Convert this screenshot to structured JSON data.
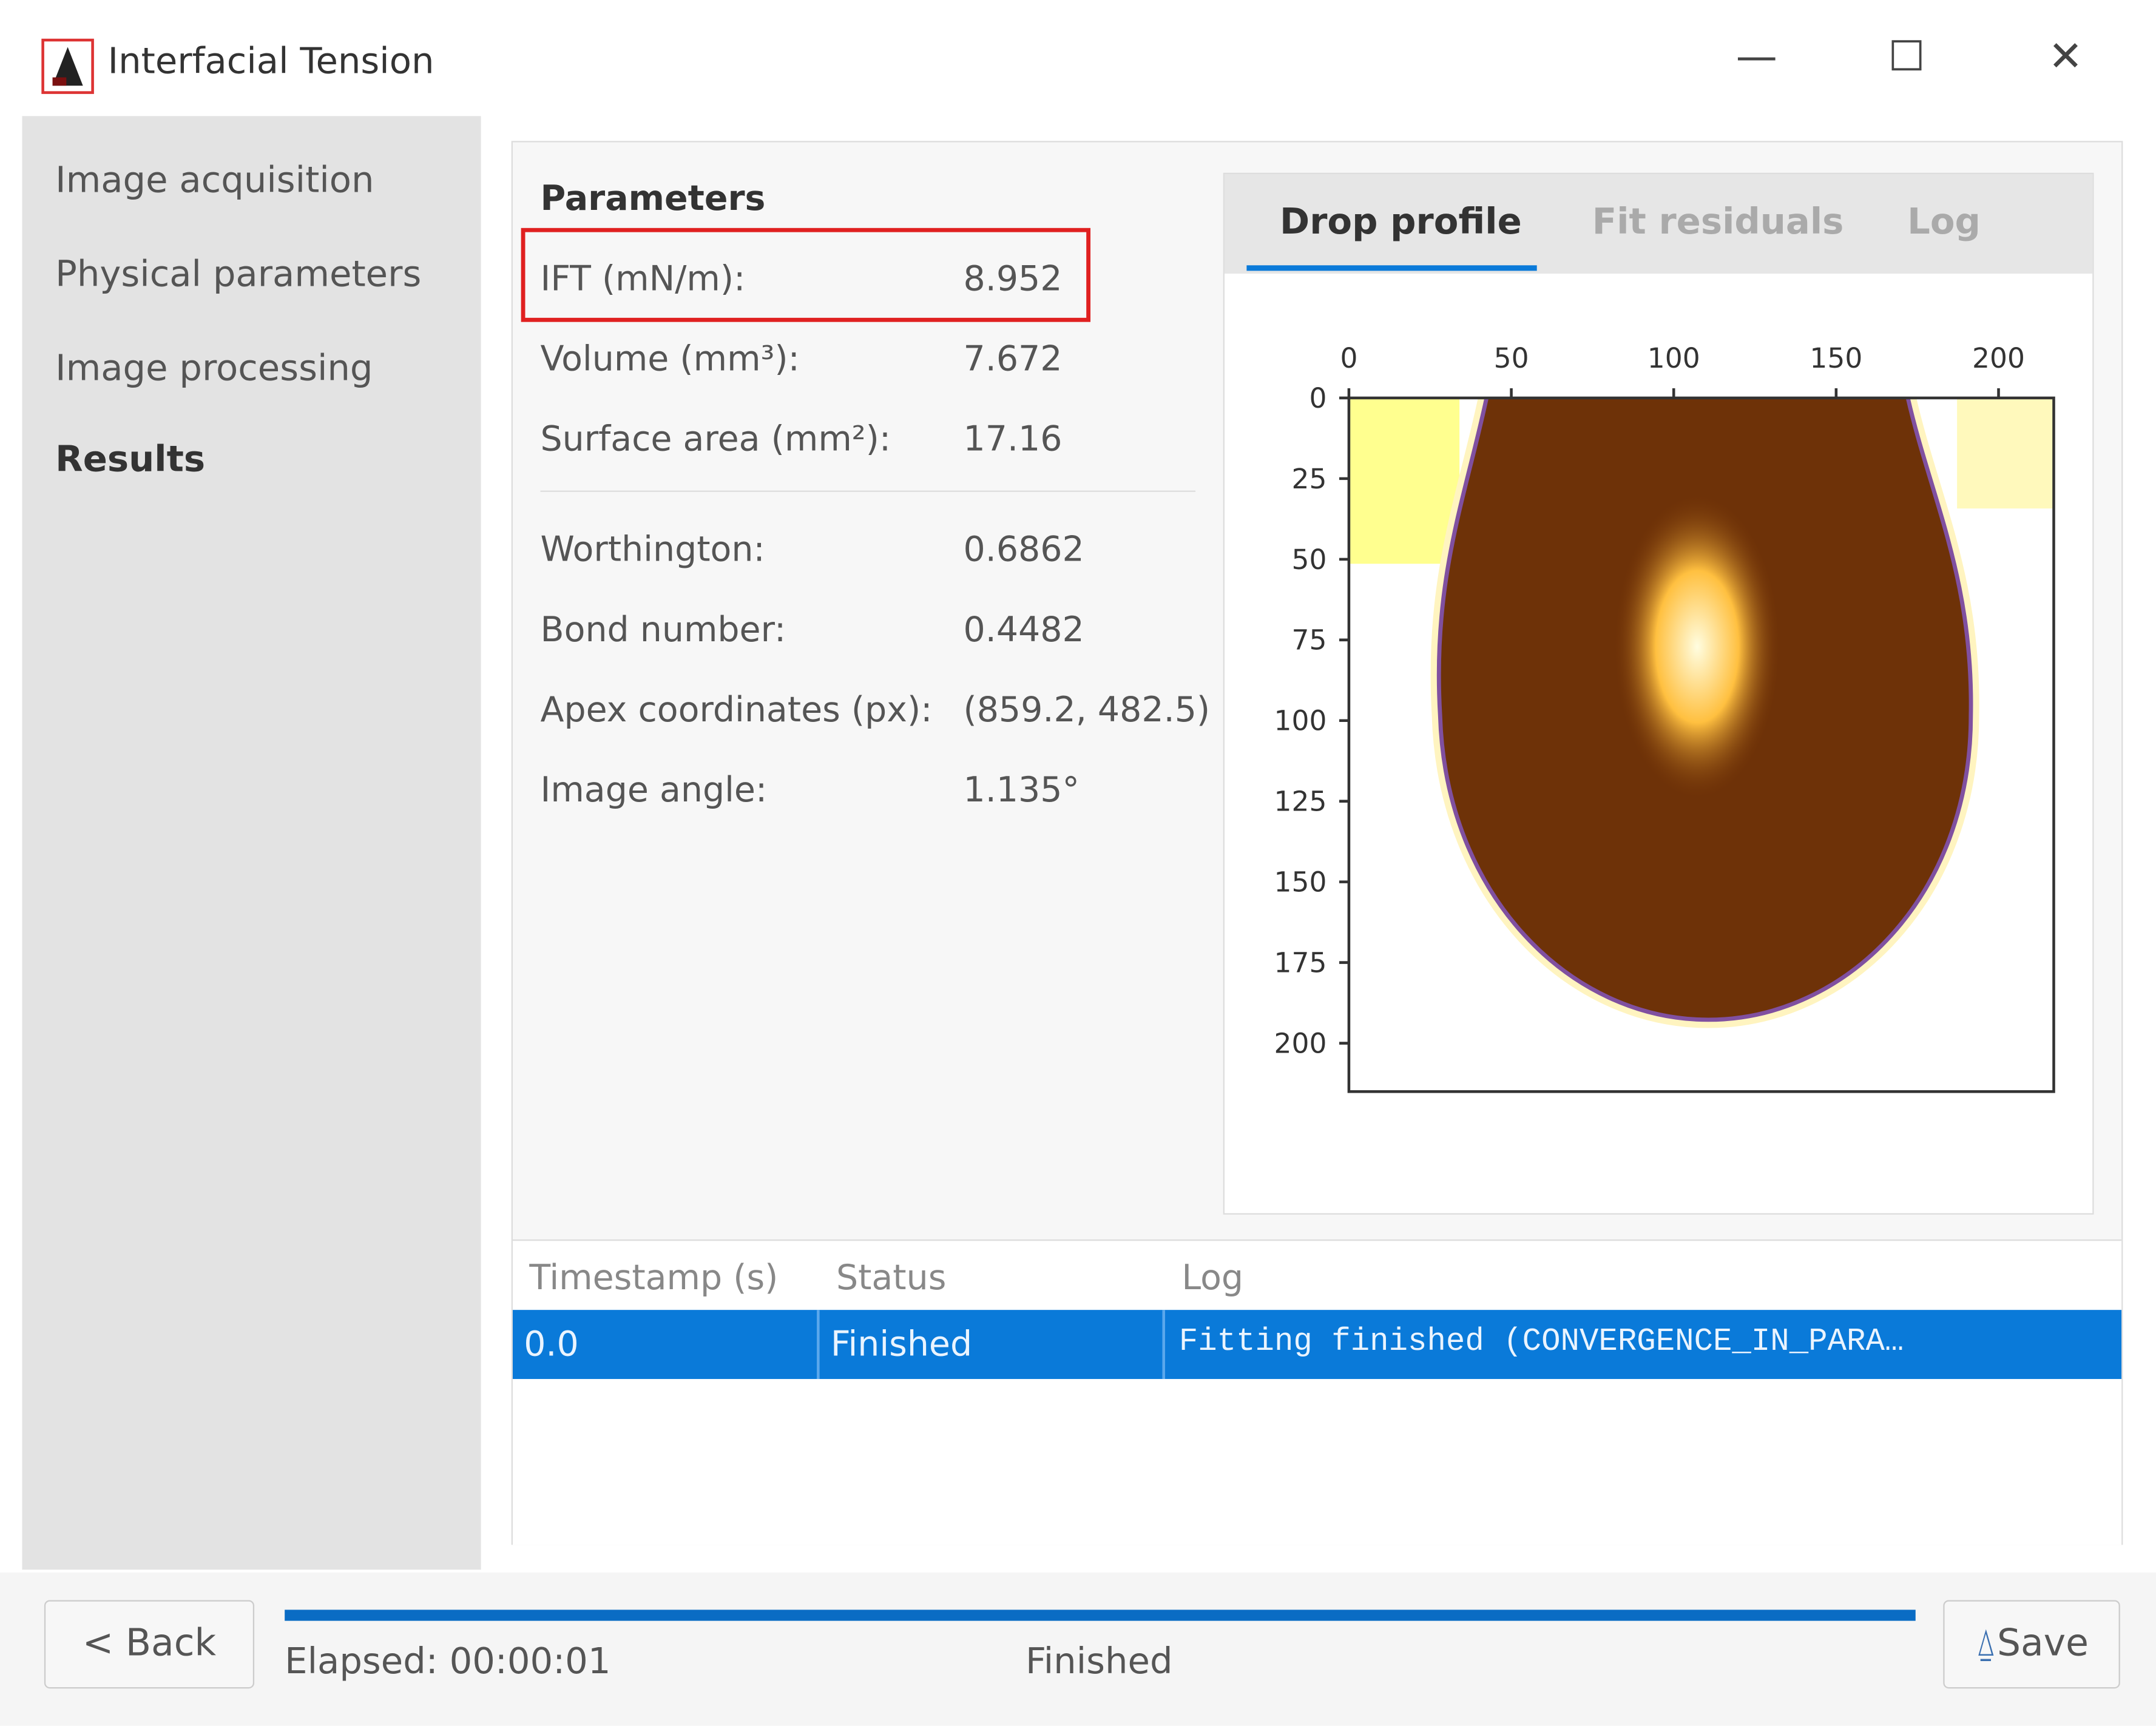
{
  "window": {
    "title": "Interfacial Tension",
    "minimize": "—",
    "maximize": "☐",
    "close": "✕"
  },
  "sidebar": {
    "items": [
      {
        "label": "Image acquisition"
      },
      {
        "label": "Physical parameters"
      },
      {
        "label": "Image processing"
      },
      {
        "label": "Results"
      }
    ]
  },
  "parameters": {
    "heading": "Parameters",
    "rows": [
      {
        "label": "IFT (mN/m):",
        "value": "8.952"
      },
      {
        "label": "Volume (mm³):",
        "value": "7.672"
      },
      {
        "label": "Surface area (mm²):",
        "value": "17.16"
      },
      {
        "label": "Worthington:",
        "value": "0.6862"
      },
      {
        "label": "Bond number:",
        "value": "0.4482"
      },
      {
        "label": "Apex coordinates (px):",
        "value": "(859.2, 482.5)"
      },
      {
        "label": "Image angle:",
        "value": "1.135°"
      }
    ]
  },
  "tabs": [
    {
      "label": "Drop profile"
    },
    {
      "label": "Fit residuals"
    },
    {
      "label": "Log"
    }
  ],
  "chart_data": {
    "type": "image",
    "x_ticks": [
      "0",
      "50",
      "100",
      "150",
      "200"
    ],
    "y_ticks": [
      "0",
      "25",
      "50",
      "75",
      "100",
      "125",
      "150",
      "175",
      "200"
    ],
    "xlim": [
      0,
      217
    ],
    "ylim": [
      215,
      0
    ]
  },
  "table": {
    "headers": [
      "Timestamp (s)",
      "Status",
      "Log"
    ],
    "rows": [
      {
        "timestamp": "0.0",
        "status": "Finished",
        "log": "Fitting finished (CONVERGENCE_IN_PARA…"
      }
    ]
  },
  "footer": {
    "back": "< Back",
    "elapsed": "Elapsed: 00:00:01",
    "status": "Finished",
    "save": "Save",
    "progress": 1.0
  },
  "colors": {
    "accent": "#0a7ad9",
    "highlight": "#e02020"
  }
}
